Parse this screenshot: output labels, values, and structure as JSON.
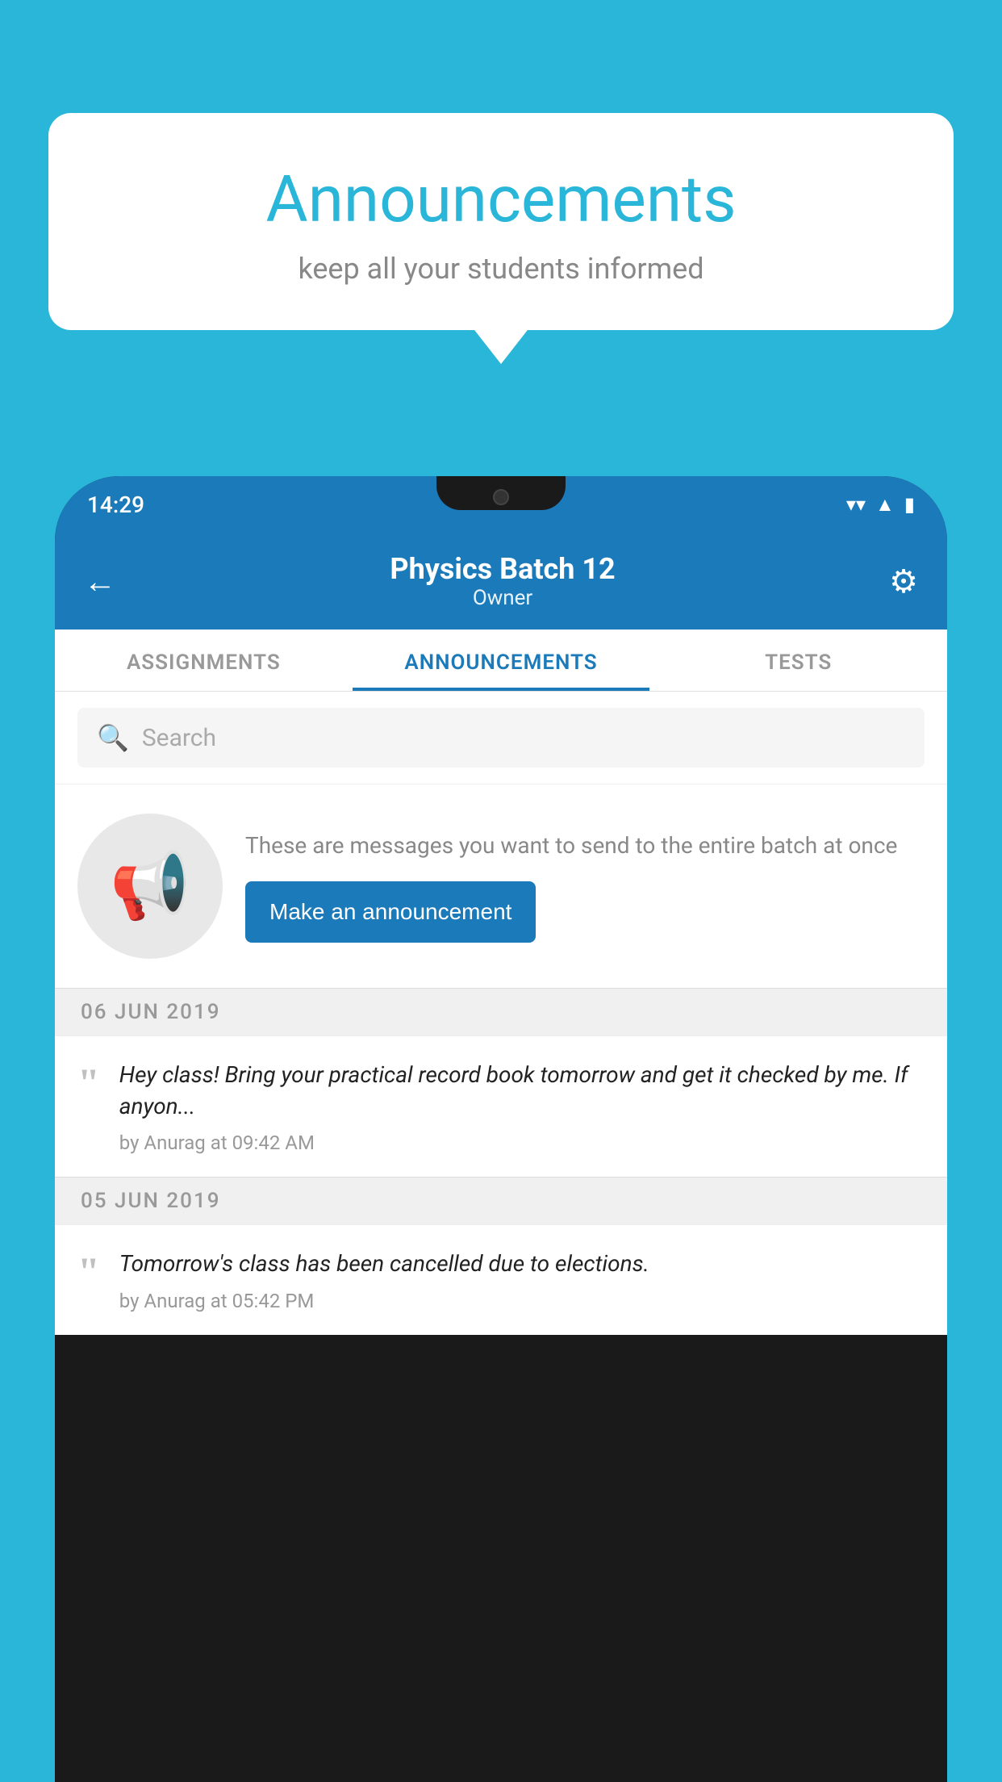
{
  "page": {
    "background_color": "#29b6d8"
  },
  "speech_bubble": {
    "title": "Announcements",
    "subtitle": "keep all your students informed"
  },
  "status_bar": {
    "time": "14:29",
    "wifi_icon": "wifi",
    "signal_icon": "signal",
    "battery_icon": "battery"
  },
  "app_header": {
    "back_label": "←",
    "title": "Physics Batch 12",
    "subtitle": "Owner",
    "settings_icon": "gear"
  },
  "tabs": [
    {
      "label": "ASSIGNMENTS",
      "active": false
    },
    {
      "label": "ANNOUNCEMENTS",
      "active": true
    },
    {
      "label": "TESTS",
      "active": false
    },
    {
      "label": "...",
      "active": false
    }
  ],
  "search": {
    "placeholder": "Search",
    "search_icon": "search"
  },
  "empty_state": {
    "icon": "megaphone",
    "description": "These are messages you want to send to the entire batch at once",
    "button_label": "Make an announcement"
  },
  "date_groups": [
    {
      "date": "06  JUN  2019",
      "announcements": [
        {
          "text": "Hey class! Bring your practical record book tomorrow and get it checked by me. If anyon...",
          "meta": "by Anurag at 09:42 AM"
        }
      ]
    },
    {
      "date": "05  JUN  2019",
      "announcements": [
        {
          "text": "Tomorrow's class has been cancelled due to elections.",
          "meta": "by Anurag at 05:42 PM"
        }
      ]
    }
  ]
}
